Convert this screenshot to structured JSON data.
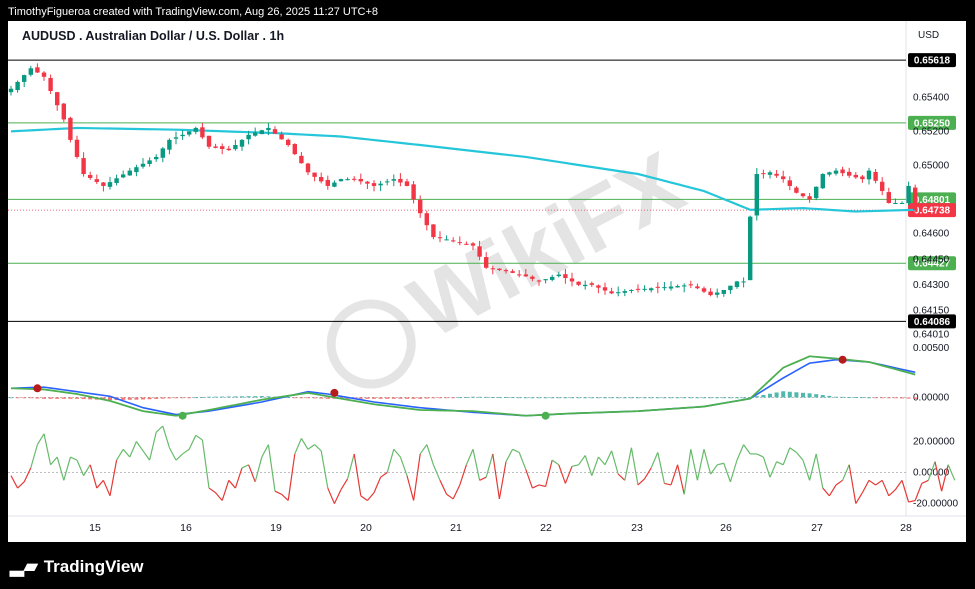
{
  "header": {
    "attribution": "TimothyFigueroa created with TradingView.com, Aug 26, 2025 11:27 UTC+8"
  },
  "footer": {
    "brand": "TradingView"
  },
  "watermark": {
    "text": "WikiFX"
  },
  "chart_data": {
    "type": "candlestick",
    "title": "AUDUSD . Australian Dollar / U.S. Dollar . 1h",
    "currency_label": "USD",
    "x_ticks": [
      "15",
      "16",
      "19",
      "20",
      "21",
      "22",
      "23",
      "26",
      "27",
      "28"
    ],
    "price_axis": {
      "range": [
        0.64,
        0.6573
      ],
      "tick_labels": [
        "0.65400",
        "0.65200",
        "0.65000",
        "0.64600",
        "0.64450",
        "0.64300",
        "0.64150",
        "0.64010",
        "0.00500"
      ],
      "tick_values": [
        0.654,
        0.652,
        0.65,
        0.646,
        0.6445,
        0.643,
        0.6415,
        0.6401
      ]
    },
    "horizontal_levels": [
      {
        "label": "0.65618",
        "value": 0.65618,
        "color": "#000000"
      },
      {
        "label": "0.65250",
        "value": 0.6525,
        "color": "#4caf50"
      },
      {
        "label": "0.64801",
        "value": 0.64801,
        "color": "#4caf50"
      },
      {
        "label": "0.64427",
        "value": 0.64427,
        "color": "#4caf50"
      },
      {
        "label": "0.64086",
        "value": 0.64086,
        "color": "#000000"
      }
    ],
    "last_price": {
      "label": "0.64738",
      "value": 0.64738,
      "color": "#f23645"
    },
    "colors": {
      "up": "#089981",
      "down": "#f23645",
      "ma": "#26c6da",
      "macd_fast": "#4caf50",
      "macd_slow": "#2962ff",
      "signal_down": "#b71c1c"
    },
    "price_path": [
      [
        0,
        0.6545
      ],
      [
        3,
        0.6557
      ],
      [
        5,
        0.6552
      ],
      [
        8,
        0.6527
      ],
      [
        9,
        0.6515
      ],
      [
        11,
        0.6495
      ],
      [
        14,
        0.6488
      ],
      [
        18,
        0.6497
      ],
      [
        22,
        0.6505
      ],
      [
        24,
        0.6515
      ],
      [
        26,
        0.6518
      ],
      [
        28,
        0.6522
      ],
      [
        30,
        0.6511
      ],
      [
        33,
        0.6509
      ],
      [
        36,
        0.6518
      ],
      [
        39,
        0.6522
      ],
      [
        42,
        0.6512
      ],
      [
        45,
        0.6496
      ],
      [
        48,
        0.6488
      ],
      [
        50,
        0.6492
      ],
      [
        52,
        0.6492
      ],
      [
        55,
        0.6488
      ],
      [
        58,
        0.6492
      ],
      [
        60,
        0.6488
      ],
      [
        62,
        0.6472
      ],
      [
        64,
        0.6458
      ],
      [
        67,
        0.6456
      ],
      [
        70,
        0.6453
      ],
      [
        72,
        0.644
      ],
      [
        75,
        0.6438
      ],
      [
        78,
        0.6435
      ],
      [
        80,
        0.6432
      ],
      [
        83,
        0.6436
      ],
      [
        86,
        0.643
      ],
      [
        88,
        0.643
      ],
      [
        91,
        0.6425
      ],
      [
        94,
        0.6427
      ],
      [
        97,
        0.6428
      ],
      [
        100,
        0.6429
      ],
      [
        103,
        0.643
      ],
      [
        106,
        0.6424
      ],
      [
        108,
        0.6427
      ],
      [
        110,
        0.6432
      ],
      [
        111,
        0.6432
      ],
      [
        112,
        0.647
      ],
      [
        113,
        0.6495
      ],
      [
        115,
        0.6496
      ],
      [
        117,
        0.6492
      ],
      [
        119,
        0.6484
      ],
      [
        121,
        0.648
      ],
      [
        123,
        0.6495
      ],
      [
        125,
        0.6497
      ],
      [
        127,
        0.6494
      ],
      [
        129,
        0.6492
      ],
      [
        130,
        0.6497
      ],
      [
        132,
        0.6485
      ],
      [
        133,
        0.6478
      ],
      [
        135,
        0.6478
      ],
      [
        136,
        0.6488
      ],
      [
        137,
        0.6474
      ]
    ],
    "ma_path": [
      [
        0,
        0.652
      ],
      [
        10,
        0.6522
      ],
      [
        25,
        0.6521
      ],
      [
        40,
        0.6519
      ],
      [
        50,
        0.6517
      ],
      [
        62,
        0.6512
      ],
      [
        78,
        0.6505
      ],
      [
        95,
        0.6495
      ],
      [
        105,
        0.6485
      ],
      [
        112,
        0.6474
      ],
      [
        120,
        0.6475
      ],
      [
        128,
        0.6473
      ],
      [
        137,
        0.6474
      ]
    ],
    "macd": {
      "zero_label": "0.00000",
      "fast_path": [
        [
          0,
          0.0008
        ],
        [
          5,
          0.0007
        ],
        [
          10,
          0.0003
        ],
        [
          15,
          -0.0003
        ],
        [
          20,
          -0.0012
        ],
        [
          25,
          -0.0016
        ],
        [
          30,
          -0.0011
        ],
        [
          38,
          -0.0002
        ],
        [
          45,
          0.0004
        ],
        [
          48,
          0.0001
        ],
        [
          55,
          -0.0006
        ],
        [
          62,
          -0.0011
        ],
        [
          70,
          -0.0012
        ],
        [
          78,
          -0.0016
        ],
        [
          85,
          -0.0014
        ],
        [
          95,
          -0.0012
        ],
        [
          105,
          -0.0008
        ],
        [
          112,
          -0.0001
        ],
        [
          117,
          0.0026
        ],
        [
          121,
          0.0036
        ],
        [
          125,
          0.0034
        ],
        [
          130,
          0.0031
        ],
        [
          137,
          0.002
        ]
      ],
      "slow_path": [
        [
          0,
          0.0008
        ],
        [
          5,
          0.0009
        ],
        [
          10,
          0.0005
        ],
        [
          15,
          0.0001
        ],
        [
          20,
          -0.0009
        ],
        [
          25,
          -0.0015
        ],
        [
          30,
          -0.0012
        ],
        [
          38,
          -0.0004
        ],
        [
          45,
          0.0005
        ],
        [
          48,
          0.0003
        ],
        [
          55,
          -0.0004
        ],
        [
          62,
          -0.0009
        ],
        [
          70,
          -0.0013
        ],
        [
          78,
          -0.0016
        ],
        [
          85,
          -0.0014
        ],
        [
          95,
          -0.0012
        ],
        [
          105,
          -0.0008
        ],
        [
          112,
          -0.0001
        ],
        [
          117,
          0.0017
        ],
        [
          121,
          0.003
        ],
        [
          125,
          0.0033
        ],
        [
          130,
          0.0031
        ],
        [
          137,
          0.0022
        ]
      ],
      "cross_markers": [
        {
          "x": 4,
          "y": 0.0008,
          "color": "#b71c1c"
        },
        {
          "x": 26,
          "y": -0.0016,
          "color": "#4caf50"
        },
        {
          "x": 49,
          "y": 0.0004,
          "color": "#b71c1c"
        },
        {
          "x": 81,
          "y": -0.0016,
          "color": "#4caf50"
        },
        {
          "x": 126,
          "y": 0.0033,
          "color": "#b71c1c"
        }
      ],
      "y_range": [
        -0.0025,
        0.0045
      ]
    },
    "oscillator": {
      "tick_labels": [
        "20.00000",
        "0.00000",
        "-20.00000"
      ],
      "tick_values": [
        20,
        0,
        -20
      ],
      "y_range": [
        -28,
        30
      ],
      "values": [
        -2,
        -10,
        -6,
        3,
        18,
        25,
        5,
        10,
        -5,
        10,
        8,
        -2,
        5,
        -10,
        -5,
        -15,
        8,
        15,
        10,
        20,
        14,
        8,
        26,
        30,
        16,
        8,
        12,
        15,
        24,
        21,
        -10,
        -13,
        -18,
        -5,
        -10,
        3,
        5,
        -6,
        10,
        18,
        -12,
        -14,
        -18,
        12,
        22,
        15,
        18,
        14,
        -10,
        -20,
        -11,
        -4,
        12,
        -15,
        -18,
        -13,
        -3,
        0,
        15,
        10,
        -2,
        -18,
        12,
        18,
        5,
        -5,
        -14,
        -17,
        -8,
        5,
        15,
        -5,
        -3,
        12,
        -17,
        7,
        15,
        13,
        2,
        -10,
        -8,
        -9,
        8,
        5,
        -7,
        4,
        5,
        11,
        -2,
        10,
        5,
        14,
        -1,
        -5,
        16,
        -8,
        -4,
        3,
        13,
        -7,
        -8,
        5,
        -14,
        15,
        -5,
        15,
        -1,
        5,
        6,
        -6,
        8,
        18,
        12,
        12,
        10,
        -3,
        7,
        5,
        16,
        13,
        8,
        -5,
        12,
        -10,
        -15,
        -8,
        -5,
        5,
        -20,
        -13,
        -5,
        -8,
        -5,
        -15,
        -11,
        -5,
        -19,
        -18,
        -7,
        -5,
        7,
        -12,
        5,
        -5
      ]
    }
  }
}
